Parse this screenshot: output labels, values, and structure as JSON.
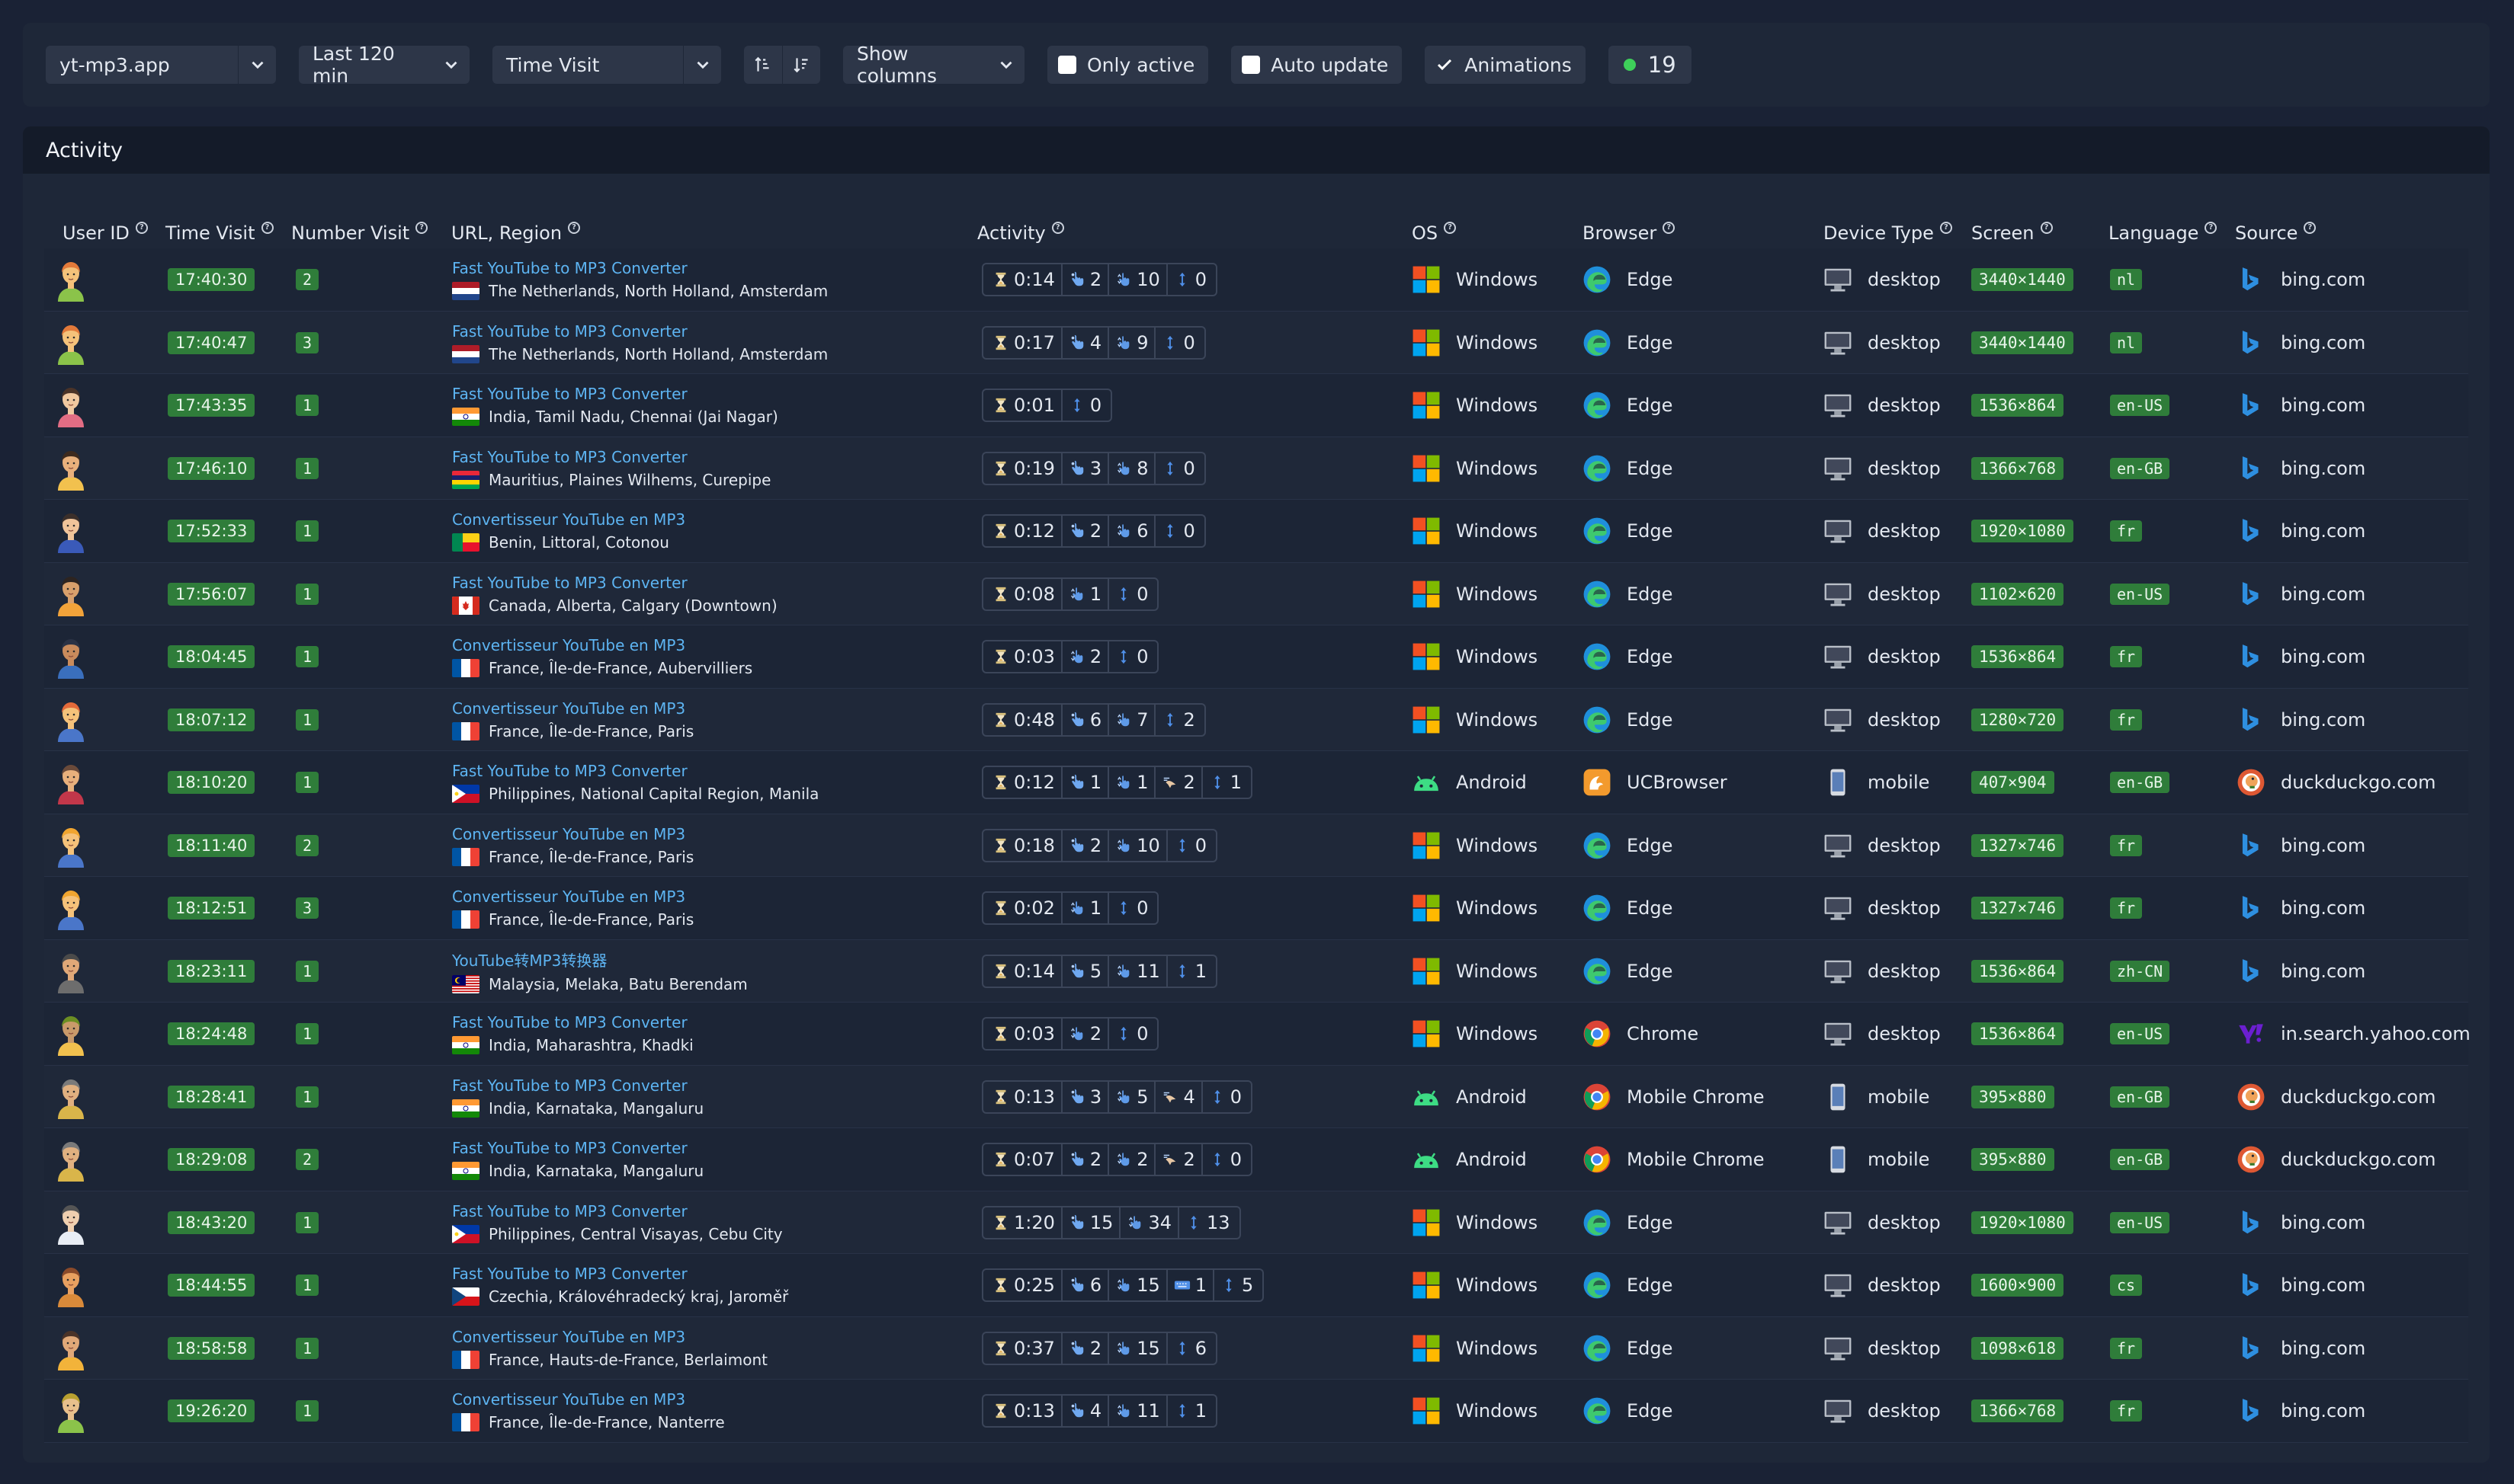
{
  "toolbar": {
    "site": "yt-mp3.app",
    "range": "Last 120 min",
    "sort_field": "Time Visit",
    "show_columns": "Show columns",
    "only_active": "Only active",
    "auto_update": "Auto update",
    "animations": "Animations",
    "count": "19"
  },
  "card": {
    "title": "Activity"
  },
  "columns": {
    "user_id": "User ID",
    "time_visit": "Time Visit",
    "number_visit": "Number Visit",
    "url_region": "URL, Region",
    "activity": "Activity",
    "os": "OS",
    "browser": "Browser",
    "device": "Device Type",
    "screen": "Screen",
    "language": "Language",
    "source": "Source"
  },
  "colors": {
    "badge_green": "#2f7d3a",
    "link_blue": "#5db4f2",
    "online_dot": "#3ecf5a"
  },
  "rows": [
    {
      "avatar": "a1",
      "time": "17:40:30",
      "visits": "2",
      "url": "Fast YouTube to MP3 Converter",
      "flag": "nl",
      "region": "The Netherlands, North Holland, Amsterdam",
      "activity": [
        [
          "time",
          "0:14"
        ],
        [
          "click",
          "2"
        ],
        [
          "scroll",
          "10"
        ],
        [
          "move",
          "0"
        ]
      ],
      "os": "Windows",
      "browser": "Edge",
      "device": "desktop",
      "screen": "3440×1440",
      "lang": "nl",
      "source": "bing.com"
    },
    {
      "avatar": "a1",
      "time": "17:40:47",
      "visits": "3",
      "url": "Fast YouTube to MP3 Converter",
      "flag": "nl",
      "region": "The Netherlands, North Holland, Amsterdam",
      "activity": [
        [
          "time",
          "0:17"
        ],
        [
          "click",
          "4"
        ],
        [
          "scroll",
          "9"
        ],
        [
          "move",
          "0"
        ]
      ],
      "os": "Windows",
      "browser": "Edge",
      "device": "desktop",
      "screen": "3440×1440",
      "lang": "nl",
      "source": "bing.com"
    },
    {
      "avatar": "a2",
      "time": "17:43:35",
      "visits": "1",
      "url": "Fast YouTube to MP3 Converter",
      "flag": "in",
      "region": "India, Tamil Nadu, Chennai (Jai Nagar)",
      "activity": [
        [
          "time",
          "0:01"
        ],
        [
          "move",
          "0"
        ]
      ],
      "os": "Windows",
      "browser": "Edge",
      "device": "desktop",
      "screen": "1536×864",
      "lang": "en-US",
      "source": "bing.com"
    },
    {
      "avatar": "a3",
      "time": "17:46:10",
      "visits": "1",
      "url": "Fast YouTube to MP3 Converter",
      "flag": "mu",
      "region": "Mauritius, Plaines Wilhems, Curepipe",
      "activity": [
        [
          "time",
          "0:19"
        ],
        [
          "click",
          "3"
        ],
        [
          "scroll",
          "8"
        ],
        [
          "move",
          "0"
        ]
      ],
      "os": "Windows",
      "browser": "Edge",
      "device": "desktop",
      "screen": "1366×768",
      "lang": "en-GB",
      "source": "bing.com"
    },
    {
      "avatar": "a4",
      "time": "17:52:33",
      "visits": "1",
      "url": "Convertisseur YouTube en MP3",
      "flag": "bj",
      "region": "Benin, Littoral, Cotonou",
      "activity": [
        [
          "time",
          "0:12"
        ],
        [
          "click",
          "2"
        ],
        [
          "scroll",
          "6"
        ],
        [
          "move",
          "0"
        ]
      ],
      "os": "Windows",
      "browser": "Edge",
      "device": "desktop",
      "screen": "1920×1080",
      "lang": "fr",
      "source": "bing.com"
    },
    {
      "avatar": "a5",
      "time": "17:56:07",
      "visits": "1",
      "url": "Fast YouTube to MP3 Converter",
      "flag": "ca",
      "region": "Canada, Alberta, Calgary (Downtown)",
      "activity": [
        [
          "time",
          "0:08"
        ],
        [
          "scroll",
          "1"
        ],
        [
          "move",
          "0"
        ]
      ],
      "os": "Windows",
      "browser": "Edge",
      "device": "desktop",
      "screen": "1102×620",
      "lang": "en-US",
      "source": "bing.com"
    },
    {
      "avatar": "a6",
      "time": "18:04:45",
      "visits": "1",
      "url": "Convertisseur YouTube en MP3",
      "flag": "fr",
      "region": "France, Île-de-France, Aubervilliers",
      "activity": [
        [
          "time",
          "0:03"
        ],
        [
          "scroll",
          "2"
        ],
        [
          "move",
          "0"
        ]
      ],
      "os": "Windows",
      "browser": "Edge",
      "device": "desktop",
      "screen": "1536×864",
      "lang": "fr",
      "source": "bing.com"
    },
    {
      "avatar": "a7",
      "time": "18:07:12",
      "visits": "1",
      "url": "Convertisseur YouTube en MP3",
      "flag": "fr",
      "region": "France, Île-de-France, Paris",
      "activity": [
        [
          "time",
          "0:48"
        ],
        [
          "click",
          "6"
        ],
        [
          "scroll",
          "7"
        ],
        [
          "move",
          "2"
        ]
      ],
      "os": "Windows",
      "browser": "Edge",
      "device": "desktop",
      "screen": "1280×720",
      "lang": "fr",
      "source": "bing.com"
    },
    {
      "avatar": "a8",
      "time": "18:10:20",
      "visits": "1",
      "url": "Fast YouTube to MP3 Converter",
      "flag": "ph",
      "region": "Philippines, National Capital Region, Manila",
      "activity": [
        [
          "time",
          "0:12"
        ],
        [
          "click",
          "1"
        ],
        [
          "scroll",
          "1"
        ],
        [
          "swipe",
          "2"
        ],
        [
          "move",
          "1"
        ]
      ],
      "os": "Android",
      "browser": "UCBrowser",
      "device": "mobile",
      "screen": "407×904",
      "lang": "en-GB",
      "source": "duckduckgo.com"
    },
    {
      "avatar": "a9",
      "time": "18:11:40",
      "visits": "2",
      "url": "Convertisseur YouTube en MP3",
      "flag": "fr",
      "region": "France, Île-de-France, Paris",
      "activity": [
        [
          "time",
          "0:18"
        ],
        [
          "click",
          "2"
        ],
        [
          "scroll",
          "10"
        ],
        [
          "move",
          "0"
        ]
      ],
      "os": "Windows",
      "browser": "Edge",
      "device": "desktop",
      "screen": "1327×746",
      "lang": "fr",
      "source": "bing.com"
    },
    {
      "avatar": "a9",
      "time": "18:12:51",
      "visits": "3",
      "url": "Convertisseur YouTube en MP3",
      "flag": "fr",
      "region": "France, Île-de-France, Paris",
      "activity": [
        [
          "time",
          "0:02"
        ],
        [
          "scroll",
          "1"
        ],
        [
          "move",
          "0"
        ]
      ],
      "os": "Windows",
      "browser": "Edge",
      "device": "desktop",
      "screen": "1327×746",
      "lang": "fr",
      "source": "bing.com"
    },
    {
      "avatar": "a10",
      "time": "18:23:11",
      "visits": "1",
      "url": "YouTube转MP3转换器",
      "flag": "my",
      "region": "Malaysia, Melaka, Batu Berendam",
      "activity": [
        [
          "time",
          "0:14"
        ],
        [
          "click",
          "5"
        ],
        [
          "scroll",
          "11"
        ],
        [
          "move",
          "1"
        ]
      ],
      "os": "Windows",
      "browser": "Edge",
      "device": "desktop",
      "screen": "1536×864",
      "lang": "zh-CN",
      "source": "bing.com"
    },
    {
      "avatar": "a11",
      "time": "18:24:48",
      "visits": "1",
      "url": "Fast YouTube to MP3 Converter",
      "flag": "in",
      "region": "India, Maharashtra, Khadki",
      "activity": [
        [
          "time",
          "0:03"
        ],
        [
          "scroll",
          "2"
        ],
        [
          "move",
          "0"
        ]
      ],
      "os": "Windows",
      "browser": "Chrome",
      "device": "desktop",
      "screen": "1536×864",
      "lang": "en-US",
      "source": "in.search.yahoo.com"
    },
    {
      "avatar": "a12",
      "time": "18:28:41",
      "visits": "1",
      "url": "Fast YouTube to MP3 Converter",
      "flag": "in",
      "region": "India, Karnataka, Mangaluru",
      "activity": [
        [
          "time",
          "0:13"
        ],
        [
          "click",
          "3"
        ],
        [
          "scroll",
          "5"
        ],
        [
          "swipe",
          "4"
        ],
        [
          "move",
          "0"
        ]
      ],
      "os": "Android",
      "browser": "Mobile Chrome",
      "device": "mobile",
      "screen": "395×880",
      "lang": "en-GB",
      "source": "duckduckgo.com"
    },
    {
      "avatar": "a12",
      "time": "18:29:08",
      "visits": "2",
      "url": "Fast YouTube to MP3 Converter",
      "flag": "in",
      "region": "India, Karnataka, Mangaluru",
      "activity": [
        [
          "time",
          "0:07"
        ],
        [
          "click",
          "2"
        ],
        [
          "scroll",
          "2"
        ],
        [
          "swipe",
          "2"
        ],
        [
          "move",
          "0"
        ]
      ],
      "os": "Android",
      "browser": "Mobile Chrome",
      "device": "mobile",
      "screen": "395×880",
      "lang": "en-GB",
      "source": "duckduckgo.com"
    },
    {
      "avatar": "a13",
      "time": "18:43:20",
      "visits": "1",
      "url": "Fast YouTube to MP3 Converter",
      "flag": "ph",
      "region": "Philippines, Central Visayas, Cebu City",
      "activity": [
        [
          "time",
          "1:20"
        ],
        [
          "click",
          "15"
        ],
        [
          "scroll",
          "34"
        ],
        [
          "move",
          "13"
        ]
      ],
      "os": "Windows",
      "browser": "Edge",
      "device": "desktop",
      "screen": "1920×1080",
      "lang": "en-US",
      "source": "bing.com"
    },
    {
      "avatar": "a14",
      "time": "18:44:55",
      "visits": "1",
      "url": "Fast YouTube to MP3 Converter",
      "flag": "cz",
      "region": "Czechia, Královéhradecký kraj, Jaroměř",
      "activity": [
        [
          "time",
          "0:25"
        ],
        [
          "click",
          "6"
        ],
        [
          "scroll",
          "15"
        ],
        [
          "keyboard",
          "1"
        ],
        [
          "move",
          "5"
        ]
      ],
      "os": "Windows",
      "browser": "Edge",
      "device": "desktop",
      "screen": "1600×900",
      "lang": "cs",
      "source": "bing.com"
    },
    {
      "avatar": "a15",
      "time": "18:58:58",
      "visits": "1",
      "url": "Convertisseur YouTube en MP3",
      "flag": "fr",
      "region": "France, Hauts-de-France, Berlaimont",
      "activity": [
        [
          "time",
          "0:37"
        ],
        [
          "click",
          "2"
        ],
        [
          "scroll",
          "15"
        ],
        [
          "move",
          "6"
        ]
      ],
      "os": "Windows",
      "browser": "Edge",
      "device": "desktop",
      "screen": "1098×618",
      "lang": "fr",
      "source": "bing.com"
    },
    {
      "avatar": "a16",
      "time": "19:26:20",
      "visits": "1",
      "url": "Convertisseur YouTube en MP3",
      "flag": "fr",
      "region": "France, Île-de-France, Nanterre",
      "activity": [
        [
          "time",
          "0:13"
        ],
        [
          "click",
          "4"
        ],
        [
          "scroll",
          "11"
        ],
        [
          "move",
          "1"
        ]
      ],
      "os": "Windows",
      "browser": "Edge",
      "device": "desktop",
      "screen": "1366×768",
      "lang": "fr",
      "source": "bing.com"
    }
  ]
}
